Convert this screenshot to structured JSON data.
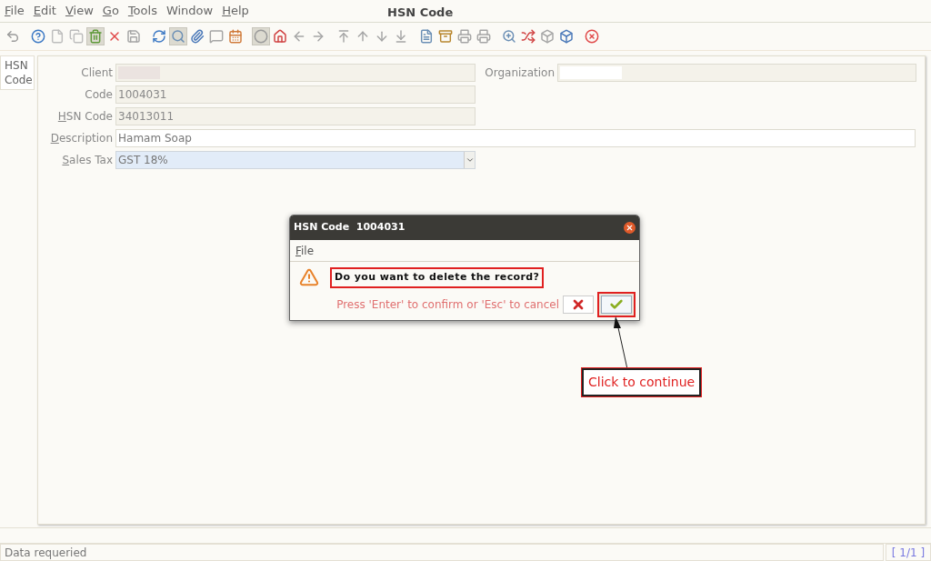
{
  "menu": [
    {
      "label": "File",
      "mnemonic": true
    },
    {
      "label": "Edit",
      "mnemonic": true
    },
    {
      "label": "View",
      "mnemonic": true
    },
    {
      "label": "Go",
      "mnemonic": true
    },
    {
      "label": "Tools",
      "mnemonic": true
    },
    {
      "label": "Window",
      "mnemonic": false
    },
    {
      "label": "Help",
      "mnemonic": true
    }
  ],
  "window": {
    "title": "HSN Code"
  },
  "toolbar": [
    [
      {
        "kind": "undo",
        "pressed": false
      }
    ],
    [
      {
        "kind": "help",
        "pressed": false
      },
      {
        "kind": "new",
        "pressed": false
      },
      {
        "kind": "copy",
        "pressed": false
      },
      {
        "kind": "delete-bin",
        "pressed": true
      },
      {
        "kind": "delete",
        "pressed": false
      },
      {
        "kind": "save",
        "pressed": false
      }
    ],
    [
      {
        "kind": "refresh",
        "pressed": false
      },
      {
        "kind": "find",
        "pressed": true
      },
      {
        "kind": "attach",
        "pressed": false
      },
      {
        "kind": "chat",
        "pressed": false
      },
      {
        "kind": "calendar",
        "pressed": false
      }
    ],
    [
      {
        "kind": "record",
        "pressed": true
      },
      {
        "kind": "home",
        "pressed": false
      },
      {
        "kind": "back",
        "pressed": false
      },
      {
        "kind": "forward",
        "pressed": false
      }
    ],
    [
      {
        "kind": "first",
        "pressed": false
      },
      {
        "kind": "up",
        "pressed": false
      },
      {
        "kind": "down",
        "pressed": false
      },
      {
        "kind": "last",
        "pressed": false
      }
    ],
    [
      {
        "kind": "report",
        "pressed": false
      },
      {
        "kind": "archive",
        "pressed": false
      },
      {
        "kind": "print",
        "pressed": false
      },
      {
        "kind": "print",
        "pressed": false
      }
    ],
    [
      {
        "kind": "zoom",
        "pressed": false
      },
      {
        "kind": "workflow",
        "pressed": false
      },
      {
        "kind": "product",
        "pressed": false
      },
      {
        "kind": "cube",
        "pressed": false
      }
    ],
    [
      {
        "kind": "exit",
        "pressed": false
      }
    ]
  ],
  "side_tab": {
    "label": "HSN Code",
    "selected": true
  },
  "form": {
    "rows": [
      {
        "fields": [
          {
            "label": "Client",
            "mnemonic": false,
            "kind": "readonly",
            "redacted": true
          },
          {
            "label": "Organization",
            "mnemonic": false,
            "kind": "readonly",
            "redacted": true
          }
        ]
      },
      {
        "fields": [
          {
            "label": "Code",
            "mnemonic": false,
            "kind": "readonly",
            "value": "1004031"
          }
        ]
      },
      {
        "fields": [
          {
            "label": "HSN Code",
            "mnemonic": true,
            "kind": "readonly",
            "value": "34013011"
          }
        ]
      },
      {
        "fields": [
          {
            "label": "Description",
            "mnemonic": true,
            "kind": "text",
            "value": "Hamam Soap"
          }
        ]
      },
      {
        "fields": [
          {
            "label": "Sales Tax",
            "mnemonic": true,
            "kind": "select",
            "value": "GST 18%"
          }
        ]
      }
    ]
  },
  "dialog": {
    "title": "HSN Code  1004031",
    "menu": [
      {
        "label": "File",
        "mnemonic": true
      }
    ],
    "message": "Do you want to delete the record?",
    "hint": "Press 'Enter' to confirm or 'Esc' to cancel"
  },
  "callout": {
    "text": "Click to continue"
  },
  "status_bar": {
    "message": "Data requeried",
    "record": "[ 1/1 ]"
  }
}
